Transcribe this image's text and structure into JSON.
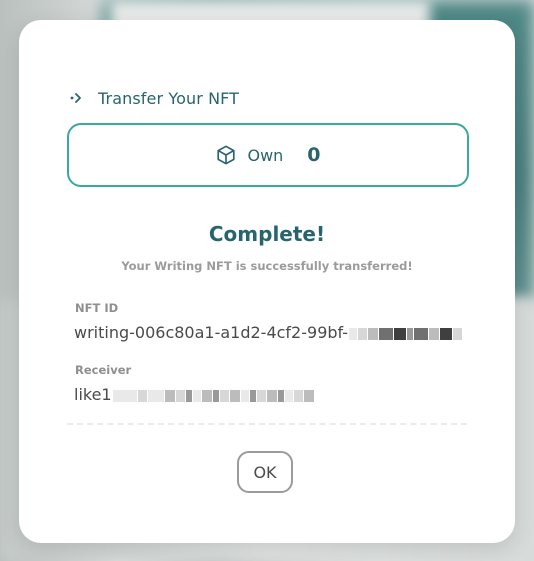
{
  "dialog": {
    "header_title": "Transfer Your NFT",
    "own": {
      "label": "Own",
      "count": "0"
    },
    "status_title": "Complete!",
    "status_message": "Your Writing NFT is successfully transferred!",
    "nft_id": {
      "label": "NFT ID",
      "value": "writing-006c80a1-a1d2-4cf2-99bf-"
    },
    "receiver": {
      "label": "Receiver",
      "value": "like1"
    },
    "ok_label": "OK"
  },
  "colors": {
    "brand_teal": "#28646e",
    "border_mint": "#3aa99b",
    "muted_text": "#9b9b9b"
  },
  "icons": {
    "header": "arrow-right-icon",
    "own": "cube-icon"
  }
}
